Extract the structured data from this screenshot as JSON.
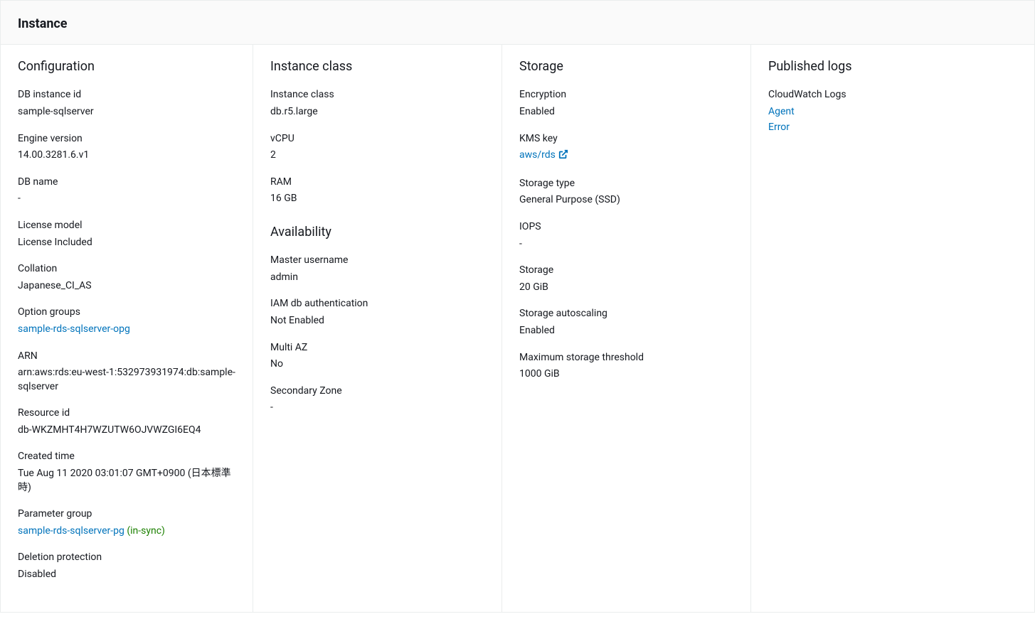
{
  "panelTitle": "Instance",
  "configuration": {
    "title": "Configuration",
    "dbInstanceId": {
      "label": "DB instance id",
      "value": "sample-sqlserver"
    },
    "engineVersion": {
      "label": "Engine version",
      "value": "14.00.3281.6.v1"
    },
    "dbName": {
      "label": "DB name",
      "value": "-"
    },
    "licenseModel": {
      "label": "License model",
      "value": "License Included"
    },
    "collation": {
      "label": "Collation",
      "value": "Japanese_CI_AS"
    },
    "optionGroups": {
      "label": "Option groups",
      "link": "sample-rds-sqlserver-opg"
    },
    "arn": {
      "label": "ARN",
      "value": "arn:aws:rds:eu-west-1:532973931974:db:sample-sqlserver"
    },
    "resourceId": {
      "label": "Resource id",
      "value": "db-WKZMHT4H7WZUTW6OJVWZGI6EQ4"
    },
    "createdTime": {
      "label": "Created time",
      "value": "Tue Aug 11 2020 03:01:07 GMT+0900 (日本標準時)"
    },
    "parameterGroup": {
      "label": "Parameter group",
      "link": "sample-rds-sqlserver-pg",
      "status": "(in-sync)"
    },
    "deletionProtection": {
      "label": "Deletion protection",
      "value": "Disabled"
    }
  },
  "instanceClass": {
    "title": "Instance class",
    "instanceClass": {
      "label": "Instance class",
      "value": "db.r5.large"
    },
    "vcpu": {
      "label": "vCPU",
      "value": "2"
    },
    "ram": {
      "label": "RAM",
      "value": "16 GB"
    }
  },
  "availability": {
    "title": "Availability",
    "masterUsername": {
      "label": "Master username",
      "value": "admin"
    },
    "iamDbAuth": {
      "label": "IAM db authentication",
      "value": "Not Enabled"
    },
    "multiAz": {
      "label": "Multi AZ",
      "value": "No"
    },
    "secondaryZone": {
      "label": "Secondary Zone",
      "value": "-"
    }
  },
  "storage": {
    "title": "Storage",
    "encryption": {
      "label": "Encryption",
      "value": "Enabled"
    },
    "kmsKey": {
      "label": "KMS key",
      "link": "aws/rds"
    },
    "storageType": {
      "label": "Storage type",
      "value": "General Purpose (SSD)"
    },
    "iops": {
      "label": "IOPS",
      "value": "-"
    },
    "storage": {
      "label": "Storage",
      "value": "20 GiB"
    },
    "storageAutoscaling": {
      "label": "Storage autoscaling",
      "value": "Enabled"
    },
    "maxStorageThreshold": {
      "label": "Maximum storage threshold",
      "value": "1000 GiB"
    }
  },
  "publishedLogs": {
    "title": "Published logs",
    "label": "CloudWatch Logs",
    "links": [
      "Agent",
      "Error"
    ]
  }
}
